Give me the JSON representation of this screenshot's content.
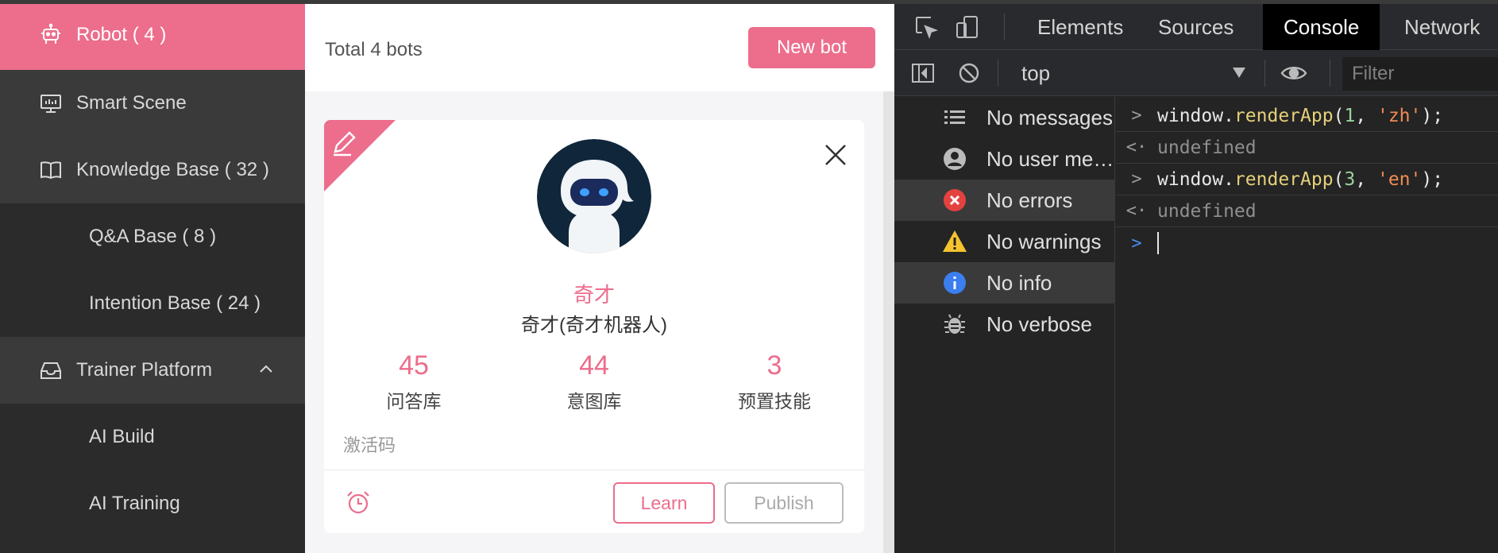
{
  "sidebar": {
    "items": [
      {
        "label": "Robot ( 4 )",
        "icon": "robot-icon"
      },
      {
        "label": "Smart Scene",
        "icon": "monitor-icon"
      },
      {
        "label": "Knowledge Base ( 32 )",
        "icon": "book-icon"
      },
      {
        "label": "Q&A Base ( 8 )"
      },
      {
        "label": "Intention Base ( 24 )"
      },
      {
        "label": "Trainer Platform",
        "icon": "inbox-icon"
      },
      {
        "label": "AI Build"
      },
      {
        "label": "AI Training"
      }
    ]
  },
  "main": {
    "total_label": "Total 4 bots",
    "new_button": "New bot",
    "card": {
      "name": "奇才",
      "subtitle": "奇才(奇才机器人)",
      "stats": [
        {
          "value": "45",
          "label": "问答库"
        },
        {
          "value": "44",
          "label": "意图库"
        },
        {
          "value": "3",
          "label": "预置技能"
        }
      ],
      "activation_label": "激活码",
      "learn_button": "Learn",
      "publish_button": "Publish"
    }
  },
  "devtools": {
    "tabs": [
      "Elements",
      "Sources",
      "Console",
      "Network"
    ],
    "active_tab": "Console",
    "context": "top",
    "filter_placeholder": "Filter",
    "sidebar": [
      "No messages",
      "No user me…",
      "No errors",
      "No warnings",
      "No info",
      "No verbose"
    ],
    "console": {
      "call1": {
        "obj": "window.",
        "fn": "renderApp",
        "open": "(",
        "num": "1",
        "comma": ", ",
        "str": "'zh'",
        "close": ");"
      },
      "result1": "undefined",
      "call2": {
        "obj": "window.",
        "fn": "renderApp",
        "open": "(",
        "num": "3",
        "comma": ", ",
        "str": "'en'",
        "close": ");"
      },
      "result2": "undefined"
    }
  },
  "colors": {
    "accent": "#ec6d8c",
    "sidebar": "#2d2d2d",
    "devtools_bg": "#242424"
  }
}
